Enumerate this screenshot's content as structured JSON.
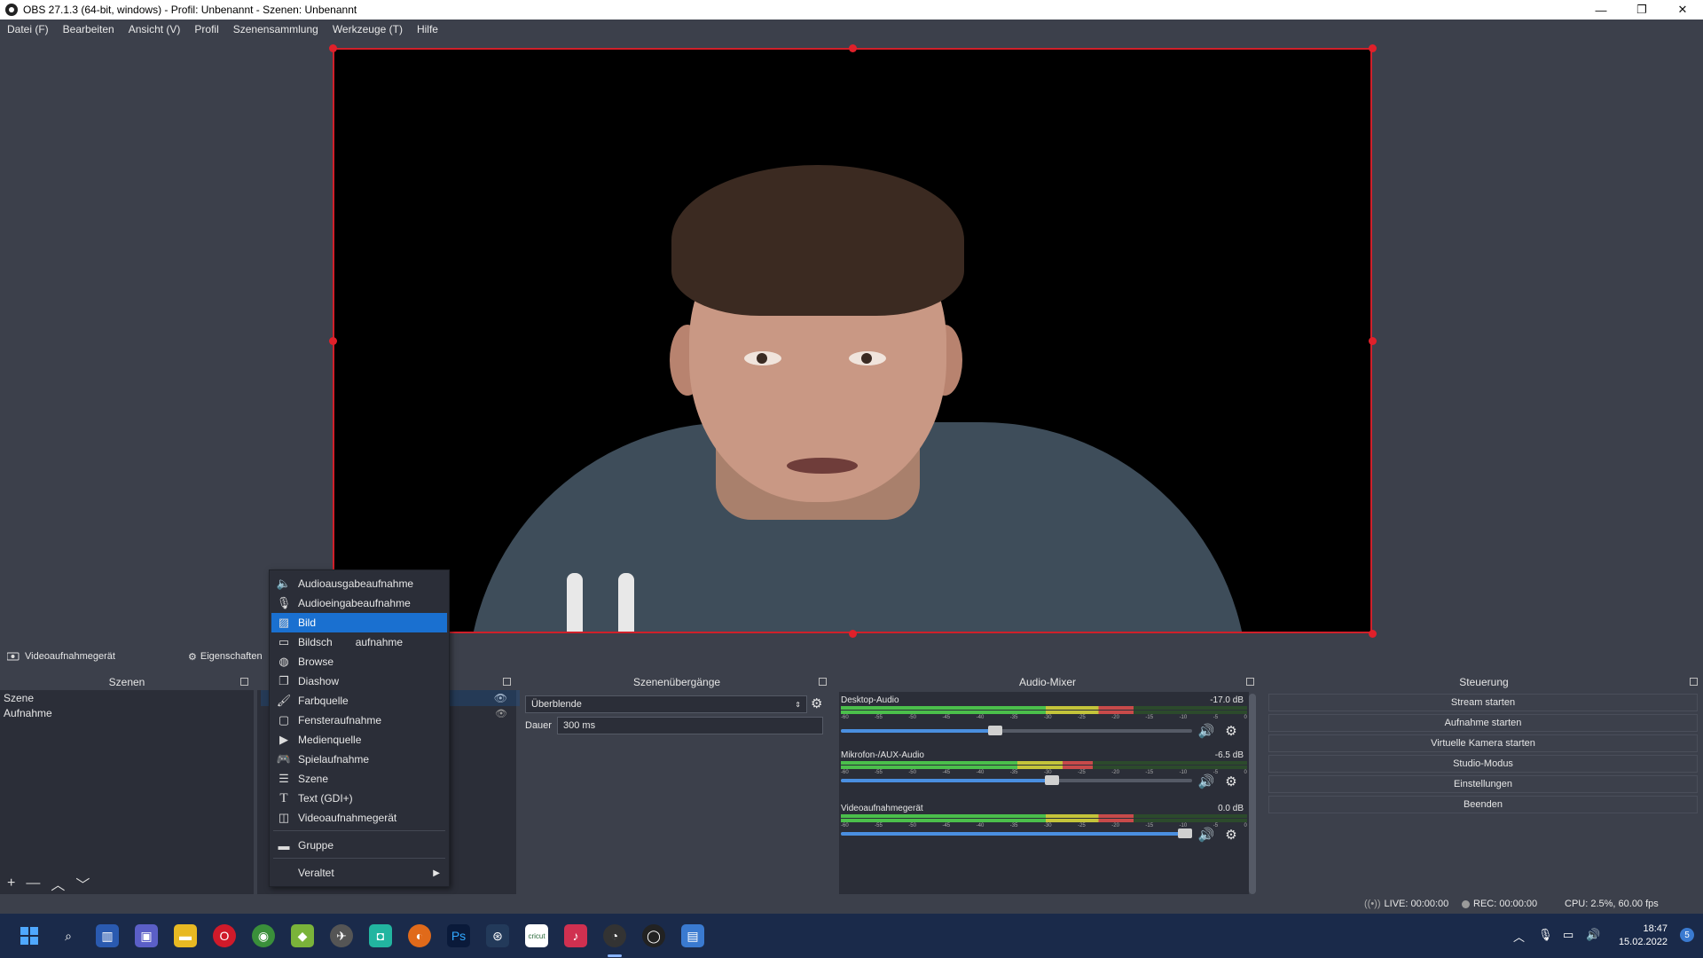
{
  "window": {
    "title": "OBS 27.1.3 (64-bit, windows) - Profil: Unbenannt - Szenen: Unbenannt",
    "minimize": "—",
    "maximize": "❐",
    "close": "✕"
  },
  "menubar": [
    "Datei (F)",
    "Bearbeiten",
    "Ansicht (V)",
    "Profil",
    "Szenensammlung",
    "Werkzeuge (T)",
    "Hilfe"
  ],
  "source_toolbar": {
    "source_name": "Videoaufnahmegerät",
    "properties": "Eigenschaften"
  },
  "scenes": {
    "header": "Szenen",
    "items": [
      "Szene",
      "Aufnahme"
    ],
    "footer_add": "+",
    "footer_remove": "—",
    "footer_up": "︿",
    "footer_down": "﹀"
  },
  "context_menu": {
    "items": [
      {
        "label": "Audioausgabeaufnahme",
        "icon": "speaker-icon"
      },
      {
        "label": "Audioeingabeaufnahme",
        "icon": "microphone-icon"
      },
      {
        "label": "Bild",
        "icon": "image-icon",
        "active": true
      },
      {
        "label": "Bildschirmaufnahme",
        "icon": "monitor-icon"
      },
      {
        "label": "Browser",
        "icon": "globe-icon"
      },
      {
        "label": "Diashow",
        "icon": "slideshow-icon"
      },
      {
        "label": "Farbquelle",
        "icon": "brush-icon"
      },
      {
        "label": "Fensteraufnahme",
        "icon": "window-icon"
      },
      {
        "label": "Medienquelle",
        "icon": "play-icon"
      },
      {
        "label": "Spielaufnahme",
        "icon": "gamepad-icon"
      },
      {
        "label": "Szene",
        "icon": "list-icon"
      },
      {
        "label": "Text (GDI+)",
        "icon": "text-icon"
      },
      {
        "label": "Videoaufnahmegerät",
        "icon": "camera-icon"
      }
    ],
    "group": {
      "label": "Gruppe",
      "icon": "folder-icon"
    },
    "deprecated": {
      "label": "Veraltet",
      "arrow": "▶"
    },
    "bildschirm_visible_label": "Bildsch",
    "bildschirm_visible_suffix": "aufnahme",
    "browser_visible_label": "Browse"
  },
  "transitions": {
    "header": "Szenenübergänge",
    "selected": "Überblende",
    "duration_label": "Dauer",
    "duration_value": "300 ms"
  },
  "audio_mixer": {
    "header": "Audio-Mixer",
    "ticks": [
      "-60",
      "-55",
      "-50",
      "-45",
      "-40",
      "-35",
      "-30",
      "-25",
      "-20",
      "-15",
      "-10",
      "-5",
      "0"
    ],
    "channels": [
      {
        "name": "Desktop-Audio",
        "db": "-17.0 dB",
        "volume": 0.44,
        "level": 0.72
      },
      {
        "name": "Mikrofon-/AUX-Audio",
        "db": "-6.5 dB",
        "volume": 0.6,
        "level": 0.62
      },
      {
        "name": "Videoaufnahmegerät",
        "db": "0.0 dB",
        "volume": 1.0,
        "level": 0.72
      }
    ]
  },
  "controls": {
    "header": "Steuerung",
    "buttons": [
      "Stream starten",
      "Aufnahme starten",
      "Virtuelle Kamera starten",
      "Studio-Modus",
      "Einstellungen",
      "Beenden"
    ]
  },
  "statusbar": {
    "live": "LIVE: 00:00:00",
    "rec": "REC: 00:00:00",
    "cpu": "CPU: 2.5%, 60.00 fps"
  },
  "taskbar": {
    "time": "18:47",
    "date": "15.02.2022",
    "notification_count": "5",
    "photoshop_label": "Ps",
    "cricut_label": "cricut"
  },
  "colors": {
    "accent": "#1a70d0",
    "selection_border": "#d0202a",
    "dock_bg": "#2b2e38",
    "window_bg": "#3c404b"
  }
}
